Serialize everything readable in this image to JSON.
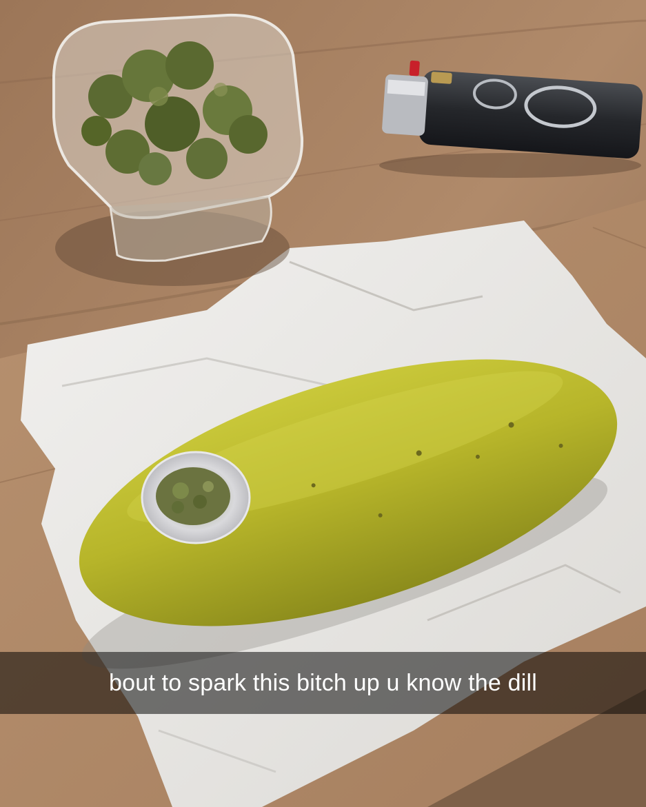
{
  "caption": {
    "text": "bout to spark this bitch up u know the dill"
  },
  "scene": {
    "objects": [
      "wooden-table",
      "brown-paper",
      "white-tissue-paper",
      "plastic-container-with-cannabis",
      "lighter",
      "pickle-pipe-with-foil-bowl"
    ],
    "colors": {
      "wood": "#a07a5c",
      "paper": "#b58e6c",
      "tissue": "#e9e7e4",
      "pickle": "#b8b82a",
      "lighter": "#2a2c30",
      "cannabis": "#5b6a32",
      "foil": "#c9c9cc",
      "caption_bg": "rgba(0,0,0,0.52)",
      "caption_text": "#ffffff"
    }
  }
}
